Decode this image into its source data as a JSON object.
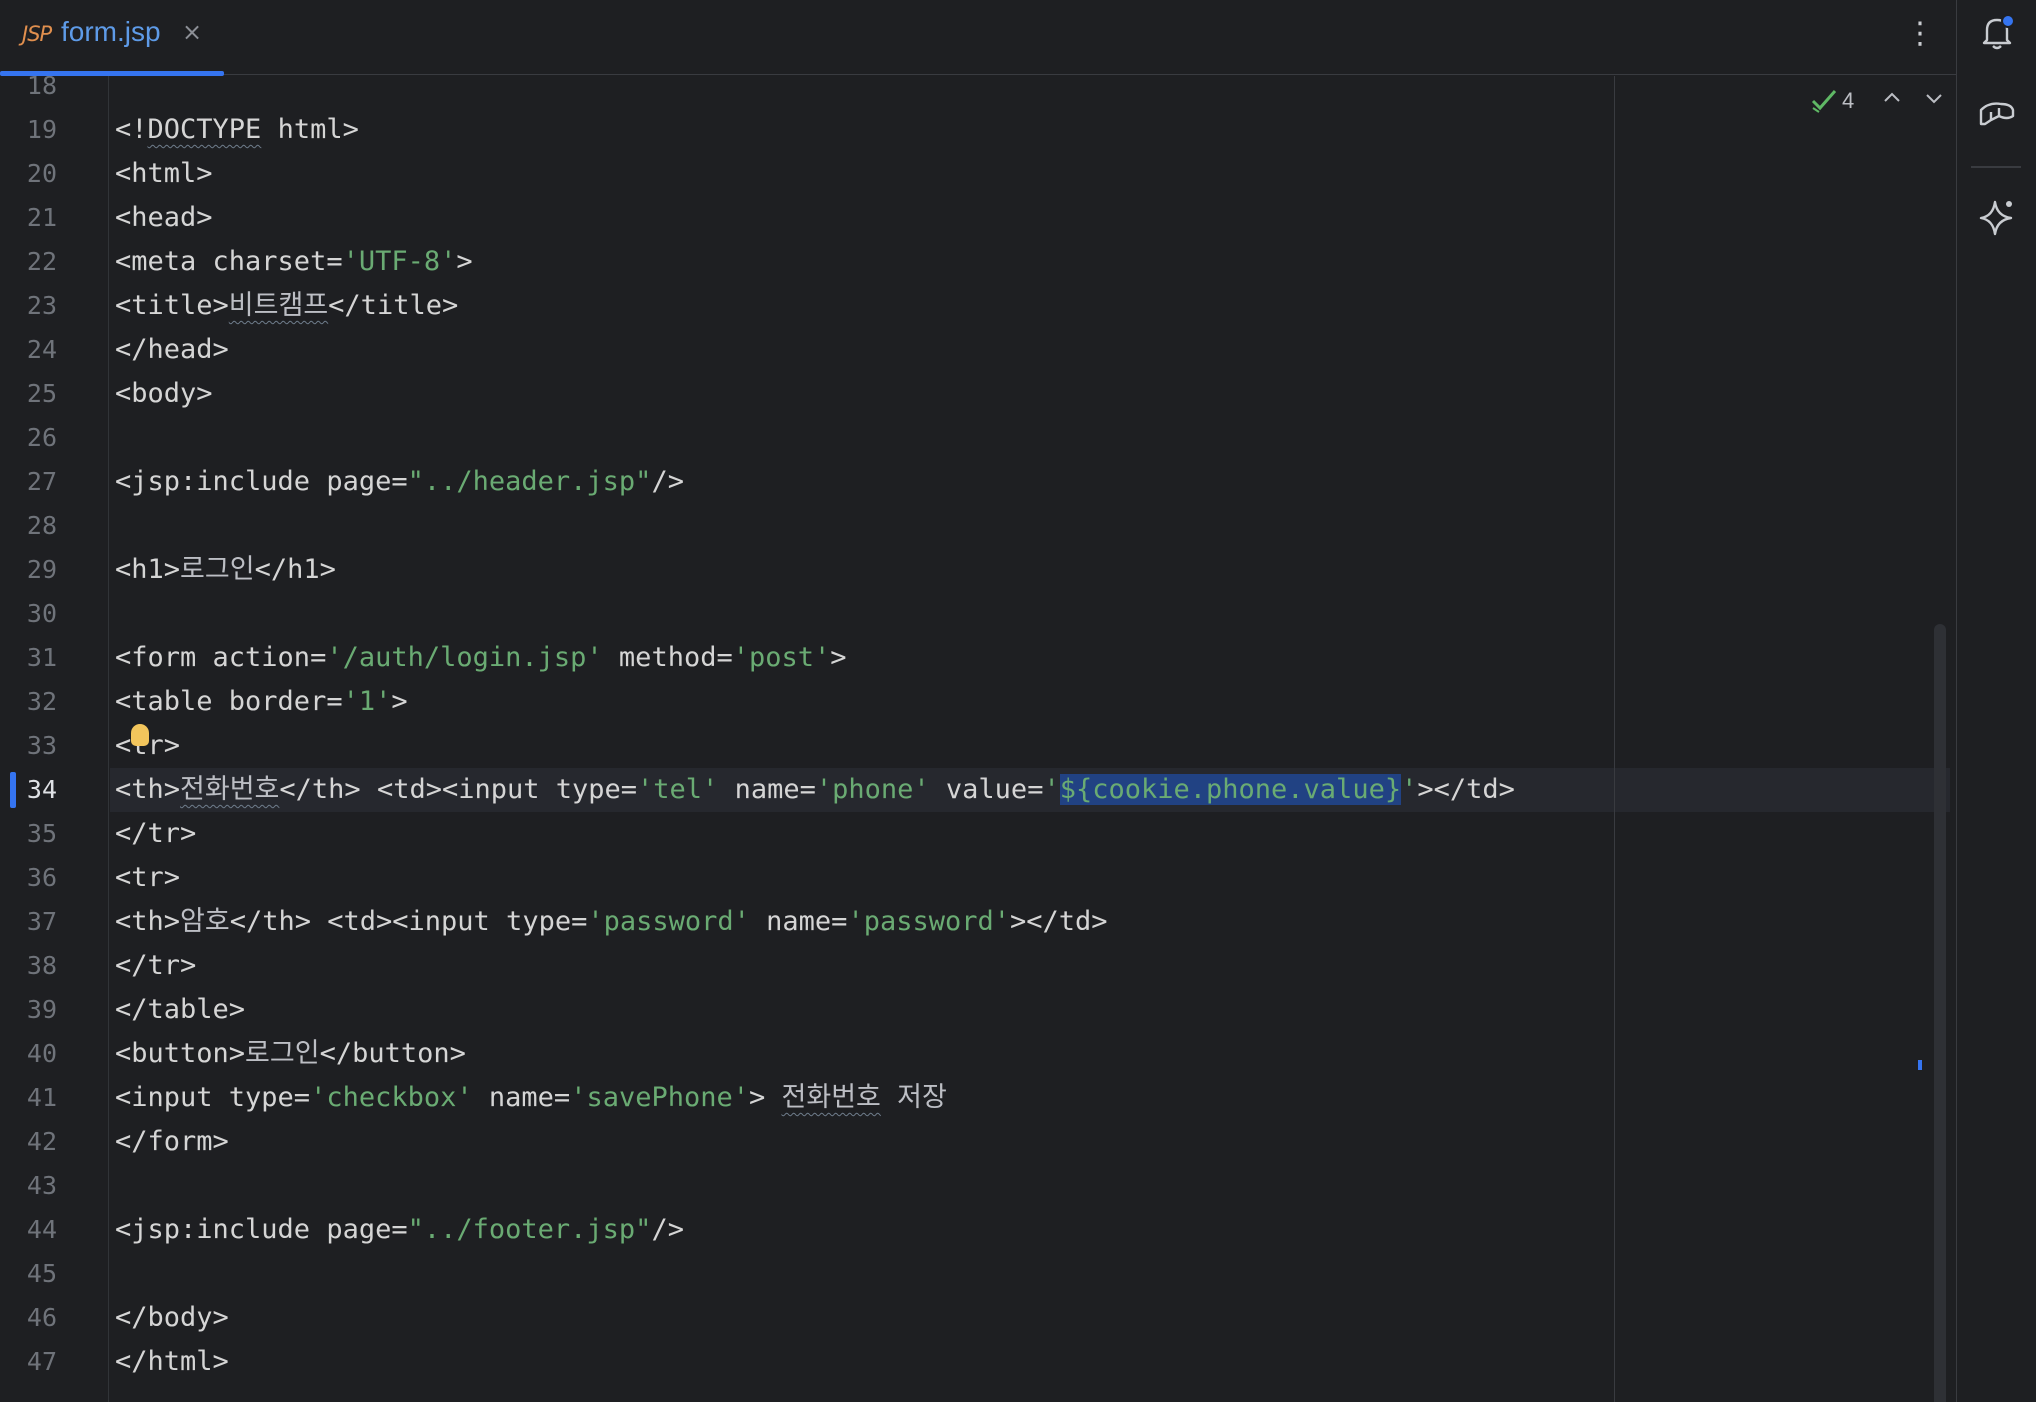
{
  "tab": {
    "badge": "JSP",
    "filename": "form.jsp",
    "close": "×"
  },
  "kebab": "⋮",
  "right_bar": {
    "icons": [
      "notifications-icon",
      "database-icon",
      "ai-assistant-icon"
    ],
    "notification_dot_color": "#3574f0"
  },
  "inspection": {
    "count": "4",
    "status": "no-errors"
  },
  "editor": {
    "current_line": 34,
    "selected_text": "${cookie.phone.value}",
    "lines": [
      {
        "n": "18",
        "segs": []
      },
      {
        "n": "19",
        "segs": [
          {
            "t": "<!",
            "c": "tag"
          },
          {
            "t": "DOCTYPE",
            "c": "tag sq"
          },
          {
            "t": " html>",
            "c": "tag"
          }
        ]
      },
      {
        "n": "20",
        "segs": [
          {
            "t": "<html>",
            "c": "tag"
          }
        ]
      },
      {
        "n": "21",
        "segs": [
          {
            "t": "<head>",
            "c": "tag"
          }
        ]
      },
      {
        "n": "22",
        "segs": [
          {
            "t": "<meta charset=",
            "c": "tag"
          },
          {
            "t": "'UTF-8'",
            "c": "str"
          },
          {
            "t": ">",
            "c": "tag"
          }
        ]
      },
      {
        "n": "23",
        "segs": [
          {
            "t": "<title>",
            "c": "tag"
          },
          {
            "t": "비트캠프",
            "c": "sq"
          },
          {
            "t": "</title>",
            "c": "tag"
          }
        ]
      },
      {
        "n": "24",
        "segs": [
          {
            "t": "</head>",
            "c": "tag"
          }
        ]
      },
      {
        "n": "25",
        "segs": [
          {
            "t": "<body>",
            "c": "tag"
          }
        ]
      },
      {
        "n": "26",
        "segs": []
      },
      {
        "n": "27",
        "segs": [
          {
            "t": "<jsp:include page=",
            "c": "tag"
          },
          {
            "t": "\"../header.jsp\"",
            "c": "str"
          },
          {
            "t": "/>",
            "c": "tag"
          }
        ]
      },
      {
        "n": "28",
        "segs": []
      },
      {
        "n": "29",
        "segs": [
          {
            "t": "<h1>",
            "c": "tag"
          },
          {
            "t": "로그인",
            "c": ""
          },
          {
            "t": "</h1>",
            "c": "tag"
          }
        ]
      },
      {
        "n": "30",
        "segs": []
      },
      {
        "n": "31",
        "segs": [
          {
            "t": "<form action=",
            "c": "tag"
          },
          {
            "t": "'/auth/login.jsp'",
            "c": "str"
          },
          {
            "t": " method=",
            "c": "tag"
          },
          {
            "t": "'post'",
            "c": "str"
          },
          {
            "t": ">",
            "c": "tag"
          }
        ]
      },
      {
        "n": "32",
        "segs": [
          {
            "t": "<table border=",
            "c": "tag"
          },
          {
            "t": "'1'",
            "c": "str"
          },
          {
            "t": ">",
            "c": "tag"
          }
        ]
      },
      {
        "n": "33",
        "segs": [
          {
            "t": "<tr>",
            "c": "tag"
          }
        ]
      },
      {
        "n": "34",
        "segs": [
          {
            "t": "<th>",
            "c": "tag"
          },
          {
            "t": "전화번호",
            "c": "sq"
          },
          {
            "t": "</th> <td><input type=",
            "c": "tag"
          },
          {
            "t": "'tel'",
            "c": "str"
          },
          {
            "t": " name=",
            "c": "tag"
          },
          {
            "t": "'phone'",
            "c": "str"
          },
          {
            "t": " value=",
            "c": "tag"
          },
          {
            "t": "'",
            "c": "str"
          },
          {
            "t": "${cookie.phone.value}",
            "c": "str sel"
          },
          {
            "t": "'",
            "c": "str"
          },
          {
            "t": "></td>",
            "c": "tag"
          }
        ]
      },
      {
        "n": "35",
        "segs": [
          {
            "t": "</tr>",
            "c": "tag"
          }
        ]
      },
      {
        "n": "36",
        "segs": [
          {
            "t": "<tr>",
            "c": "tag"
          }
        ]
      },
      {
        "n": "37",
        "segs": [
          {
            "t": "<th>",
            "c": "tag"
          },
          {
            "t": "암호",
            "c": ""
          },
          {
            "t": "</th> <td><input type=",
            "c": "tag"
          },
          {
            "t": "'password'",
            "c": "str"
          },
          {
            "t": " name=",
            "c": "tag"
          },
          {
            "t": "'password'",
            "c": "str"
          },
          {
            "t": "></td>",
            "c": "tag"
          }
        ]
      },
      {
        "n": "38",
        "segs": [
          {
            "t": "</tr>",
            "c": "tag"
          }
        ]
      },
      {
        "n": "39",
        "segs": [
          {
            "t": "</table>",
            "c": "tag"
          }
        ]
      },
      {
        "n": "40",
        "segs": [
          {
            "t": "<button>",
            "c": "tag"
          },
          {
            "t": "로그인",
            "c": ""
          },
          {
            "t": "</button>",
            "c": "tag"
          }
        ]
      },
      {
        "n": "41",
        "segs": [
          {
            "t": "<input type=",
            "c": "tag"
          },
          {
            "t": "'checkbox'",
            "c": "str"
          },
          {
            "t": " name=",
            "c": "tag"
          },
          {
            "t": "'savePhone'",
            "c": "str"
          },
          {
            "t": "> ",
            "c": "tag"
          },
          {
            "t": "전화번호",
            "c": "sq"
          },
          {
            "t": " 저장",
            "c": ""
          }
        ]
      },
      {
        "n": "42",
        "segs": [
          {
            "t": "</form>",
            "c": "tag"
          }
        ]
      },
      {
        "n": "43",
        "segs": []
      },
      {
        "n": "44",
        "segs": [
          {
            "t": "<jsp:include page=",
            "c": "tag"
          },
          {
            "t": "\"../footer.jsp\"",
            "c": "str"
          },
          {
            "t": "/>",
            "c": "tag"
          }
        ]
      },
      {
        "n": "45",
        "segs": []
      },
      {
        "n": "46",
        "segs": [
          {
            "t": "</body>",
            "c": "tag"
          }
        ]
      },
      {
        "n": "47",
        "segs": [
          {
            "t": "</html>",
            "c": "tag"
          }
        ]
      }
    ]
  }
}
